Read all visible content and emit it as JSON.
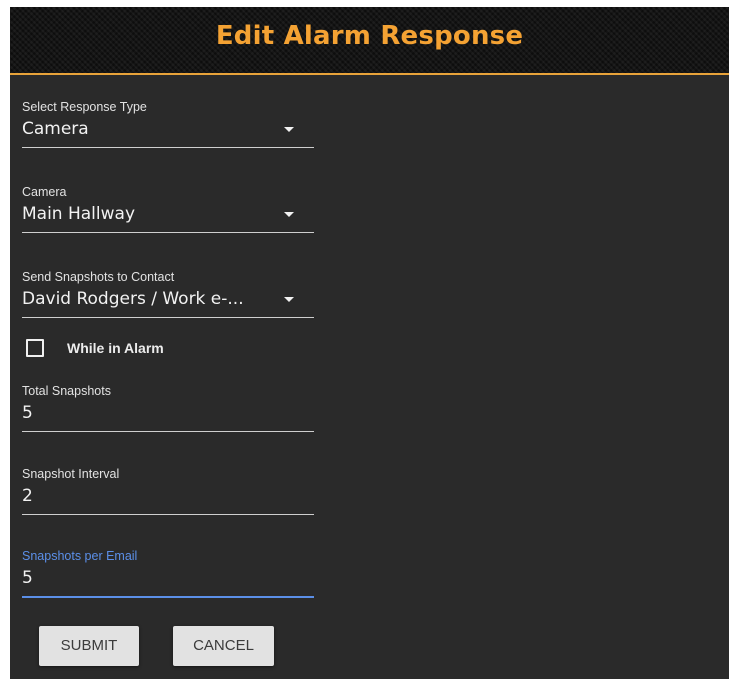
{
  "dialog": {
    "title": "Edit Alarm Response"
  },
  "colors": {
    "title_accent": "#f4a233",
    "header_border": "#e8a33a",
    "panel_background": "#2a2a2a",
    "focus_accent": "#5b8fe8",
    "button_background": "#e2e2e2"
  },
  "fields": {
    "response_type": {
      "label": "Select Response Type",
      "value": "Camera",
      "icon": "caret-down-icon"
    },
    "camera": {
      "label": "Camera",
      "value": "Main Hallway",
      "icon": "caret-down-icon"
    },
    "contact": {
      "label": "Send Snapshots to Contact",
      "value": "David Rodgers / Work e-...",
      "icon": "caret-down-icon"
    },
    "while_in_alarm": {
      "label": "While in Alarm",
      "checked": false
    },
    "total_snapshots": {
      "label": "Total Snapshots",
      "value": "5"
    },
    "snapshot_interval": {
      "label": "Snapshot Interval",
      "value": "2"
    },
    "snapshots_per_email": {
      "label": "Snapshots per Email",
      "value": "5",
      "focused": true
    }
  },
  "actions": {
    "submit_label": "SUBMIT",
    "cancel_label": "CANCEL"
  }
}
